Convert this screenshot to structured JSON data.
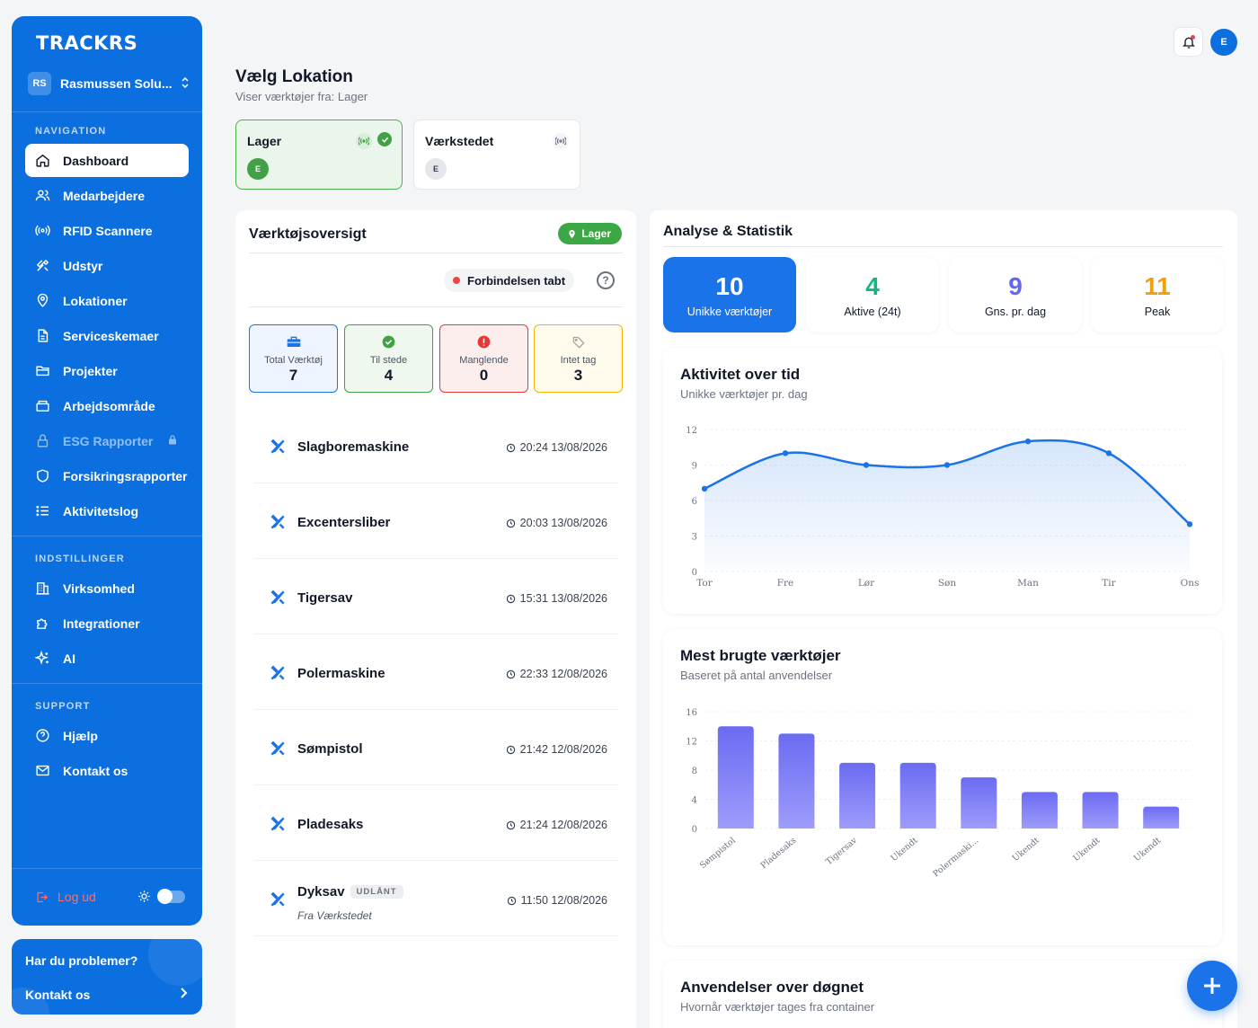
{
  "app": {
    "logo": "TRACKRS"
  },
  "company": {
    "initials": "RS",
    "name": "Rasmussen Solu..."
  },
  "sidebar": {
    "nav_title": "NAVIGATION",
    "nav": [
      {
        "label": "Dashboard",
        "icon": "home-icon"
      },
      {
        "label": "Medarbejdere",
        "icon": "users-icon"
      },
      {
        "label": "RFID Scannere",
        "icon": "rfid-icon"
      },
      {
        "label": "Udstyr",
        "icon": "tools-icon"
      },
      {
        "label": "Lokationer",
        "icon": "pin-icon"
      },
      {
        "label": "Serviceskemaer",
        "icon": "document-icon"
      },
      {
        "label": "Projekter",
        "icon": "folder-icon"
      },
      {
        "label": "Arbejdsområde",
        "icon": "briefcase-icon"
      },
      {
        "label": "ESG Rapporter",
        "icon": "lock-icon"
      },
      {
        "label": "Forsikringsrapporter",
        "icon": "shield-icon"
      },
      {
        "label": "Aktivitetslog",
        "icon": "list-icon"
      }
    ],
    "settings_title": "INDSTILLINGER",
    "settings": [
      {
        "label": "Virksomhed",
        "icon": "building-icon"
      },
      {
        "label": "Integrationer",
        "icon": "puzzle-icon"
      },
      {
        "label": "AI",
        "icon": "sparkle-icon"
      }
    ],
    "support_title": "SUPPORT",
    "support": [
      {
        "label": "Hjælp",
        "icon": "help-icon"
      },
      {
        "label": "Kontakt os",
        "icon": "mail-icon"
      }
    ],
    "logout": "Log ud"
  },
  "help_card": {
    "title": "Har du problemer?",
    "link": "Kontakt os"
  },
  "topbar": {
    "avatar": "E"
  },
  "location": {
    "title": "Vælg Lokation",
    "subtitle": "Viser værktøjer fra: Lager",
    "cards": [
      {
        "name": "Lager",
        "avatar": "E",
        "selected": true
      },
      {
        "name": "Værkstedet",
        "avatar": "E",
        "selected": false
      }
    ]
  },
  "tools": {
    "title": "Værktøjsoversigt",
    "badge": "Lager",
    "connection": "Forbindelsen tabt",
    "stats": [
      {
        "label": "Total Værktøj",
        "value": "7",
        "color": "#1a73e8",
        "bg": "#eef5ff"
      },
      {
        "label": "Til stede",
        "value": "4",
        "color": "#43a047",
        "bg": "#eef8ee"
      },
      {
        "label": "Manglende",
        "value": "0",
        "color": "#e53935",
        "bg": "#fdeeee"
      },
      {
        "label": "Intet tag",
        "value": "3",
        "color": "#f4b400",
        "bg": "#fffaeb"
      }
    ],
    "items": [
      {
        "name": "Slagboremaskine",
        "time": "20:24 13/08/2026"
      },
      {
        "name": "Excentersliber",
        "time": "20:03 13/08/2026"
      },
      {
        "name": "Tigersav",
        "time": "15:31 13/08/2026"
      },
      {
        "name": "Polermaskine",
        "time": "22:33 12/08/2026"
      },
      {
        "name": "Sømpistol",
        "time": "21:42 12/08/2026"
      },
      {
        "name": "Pladesaks",
        "time": "21:24 12/08/2026"
      },
      {
        "name": "Dyksav",
        "time": "11:50 12/08/2026",
        "tag": "UDLÅNT",
        "from": "Fra Værkstedet"
      }
    ]
  },
  "analytics": {
    "title": "Analyse & Statistik",
    "kpis": [
      {
        "value": "10",
        "label": "Unikke værktøjer",
        "color": "#ffffff"
      },
      {
        "value": "4",
        "label": "Aktive (24t)",
        "color": "#10b981"
      },
      {
        "value": "9",
        "label": "Gns. pr. dag",
        "color": "#6366f1"
      },
      {
        "value": "11",
        "label": "Peak",
        "color": "#f59e0b"
      }
    ],
    "activity_title": "Aktivitet over tid",
    "activity_sub": "Unikke værktøjer pr. dag",
    "usage_title": "Mest brugte værktøjer",
    "usage_sub": "Baseret på antal anvendelser",
    "day_title": "Anvendelser over døgnet",
    "day_sub": "Hvornår værktøjer tages fra container"
  },
  "chart_data": [
    {
      "type": "area",
      "categories": [
        "Tor",
        "Fre",
        "Lør",
        "Søn",
        "Man",
        "Tir",
        "Ons"
      ],
      "values": [
        7,
        10,
        9,
        9,
        11,
        10,
        4
      ],
      "ylim": [
        0,
        12
      ],
      "yticks": [
        0,
        3,
        6,
        9,
        12
      ],
      "color": "#1a73e8",
      "grid": true
    },
    {
      "type": "bar",
      "categories": [
        "Sømpistol",
        "Pladesaks",
        "Tigersav",
        "Ukendt",
        "Polermaski...",
        "Ukendt",
        "Ukendt",
        "Ukendt"
      ],
      "values": [
        14,
        13,
        9,
        9,
        7,
        5,
        5,
        3
      ],
      "ylim": [
        0,
        16
      ],
      "yticks": [
        0,
        4,
        8,
        12,
        16
      ],
      "color": "#7c7cf5",
      "grid": true
    }
  ]
}
